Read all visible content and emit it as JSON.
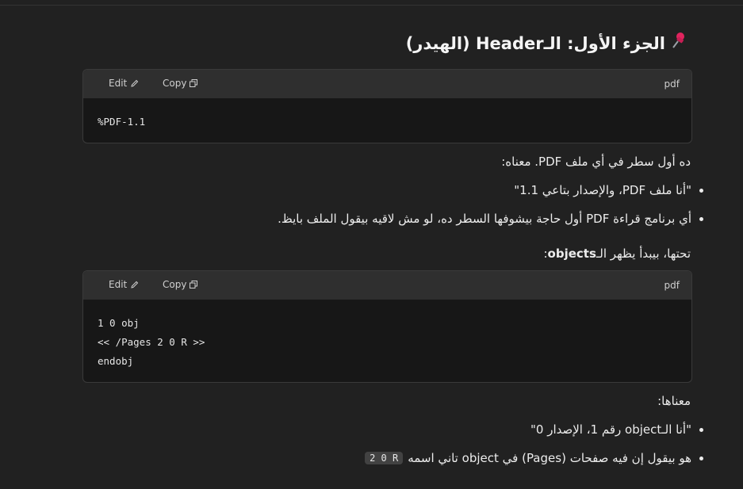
{
  "heading": {
    "text": "الجزء الأول: الـHeader (الهيدر)",
    "icon": "pushpin-icon"
  },
  "code_blocks": [
    {
      "lang": "pdf",
      "edit_label": "Edit",
      "copy_label": "Copy",
      "lines": [
        "%PDF-1.1"
      ]
    },
    {
      "lang": "pdf",
      "edit_label": "Edit",
      "copy_label": "Copy",
      "lines": [
        "1 0 obj",
        "<< /Pages 2 0 R >>",
        "endobj"
      ]
    }
  ],
  "section1": {
    "intro": "ده أول سطر في أي ملف PDF. معناه:",
    "bullets": [
      "\"أنا ملف PDF، والإصدار بتاعي 1.1\"",
      "أي برنامج قراءة PDF أول حاجة بيشوفها السطر ده، لو مش لاقيه بيقول الملف بايظ."
    ]
  },
  "section2": {
    "intro_prefix": "تحتها، بيبدأ يظهر الـ",
    "intro_bold": "objects",
    "intro_suffix": ":"
  },
  "section3": {
    "intro": "معناها:",
    "bullet1": "\"أنا الـobject رقم 1، الإصدار 0\"",
    "bullet2": "هو بيقول إن فيه صفحات (Pages) في object تاني اسمه",
    "bullet2_code": "2 0 R"
  },
  "colors": {
    "background": "#212121",
    "code_header": "#2f2f2f",
    "code_body": "#171717",
    "inline_code": "#424242",
    "text": "#ececec"
  }
}
